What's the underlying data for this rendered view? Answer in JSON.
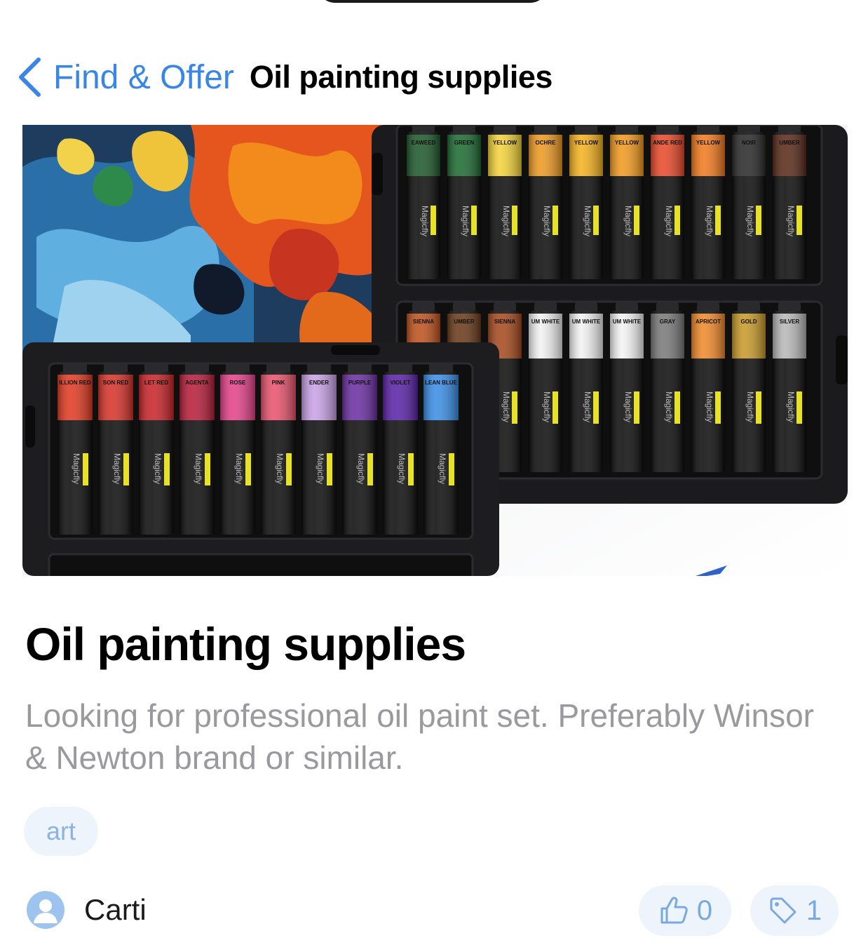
{
  "nav": {
    "back_label": "Find & Offer",
    "title": "Oil painting supplies"
  },
  "post": {
    "title": "Oil painting supplies",
    "description": "Looking for professional oil paint set. Preferably Winsor & Newton brand or similar.",
    "tags": [
      "art"
    ],
    "author": "Carti",
    "likes": "0",
    "tag_count": "1"
  },
  "colors": {
    "accent": "#3a86e6",
    "pill_bg": "#eef4fb",
    "muted_text": "#9a9a9e"
  },
  "image": {
    "tube_brand": "Magicfly",
    "tray_top_colors": [
      "#1f5a2c",
      "#1e6b33",
      "#f4d33a",
      "#ee9a22",
      "#f5b21e",
      "#f39a1e",
      "#ea4a2a",
      "#f07a1e",
      "#2a2a2a",
      "#5a2a1a"
    ],
    "tray_top_labels": [
      "EAWEED",
      "GREEN",
      "YELLOW",
      "OCHRE",
      "YELLOW",
      "YELLOW",
      "ANDE RED",
      "YELLOW",
      "NOIR",
      "UMBER"
    ],
    "tray_mid_colors": [
      "#c0521e",
      "#6b3a1a",
      "#a84a1e",
      "#f2f2f2",
      "#f2f2f2",
      "#f4f4f4",
      "#7a7a7a",
      "#f08a2a",
      "#c99a2a",
      "#b8b8b8"
    ],
    "tray_mid_labels": [
      "SIENNA",
      "UMBER",
      "SIENNA",
      "UM WHITE",
      "UM WHITE",
      "UM WHITE",
      "GRAY",
      "APRICOT",
      "GOLD",
      "SILVER"
    ],
    "tray_front_colors": [
      "#e23a22",
      "#d8332a",
      "#c9242a",
      "#b81e3a",
      "#e6428a",
      "#e9536e",
      "#c9a2e6",
      "#6b2fa3",
      "#5a23a8",
      "#3a8ee6"
    ],
    "tray_front_labels": [
      "ILLION RED",
      "SON RED",
      "LET RED",
      "AGENTA",
      "ROSE",
      "PINK",
      "ENDER",
      "PURPLE",
      "VIOLET",
      "LEAN BLUE"
    ]
  }
}
